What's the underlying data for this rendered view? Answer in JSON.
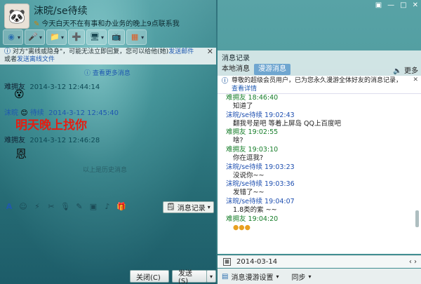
{
  "contact": {
    "name": "沫晥/se待续",
    "status": "今天白天不在有事和办业务的晚上9点联系我",
    "avatar_glyph": "🐼"
  },
  "toolbar": {
    "items": [
      {
        "name": "video-call-icon",
        "glyph": "◉"
      },
      {
        "name": "voice-call-icon",
        "glyph": "🎤"
      },
      {
        "name": "folder-icon",
        "glyph": "📁"
      },
      {
        "name": "add-contact-icon",
        "glyph": "➕"
      },
      {
        "name": "remote-icon",
        "glyph": "🖥"
      },
      {
        "name": "screen-share-icon",
        "glyph": "📺"
      },
      {
        "name": "apps-icon",
        "glyph": "▦"
      }
    ]
  },
  "notice": {
    "text": "对方\"离线或隐身\"，可能无法立即回复，您可以给他(她)",
    "link1": "发送邮件",
    "mid": "或者",
    "link2": "发送离线文件"
  },
  "conversation": {
    "more_messages": "查看更多消息",
    "messages": [
      {
        "who": "难拥友",
        "time": "2014-3-12 12:44:14"
      },
      {
        "who": "沫晥",
        "who_suffix": "待续",
        "time": "2014-3-12 12:45:40",
        "text": "明天晚上找你"
      },
      {
        "who": "难拥友",
        "time": "2014-3-12 12:46:28",
        "text": "恩"
      }
    ],
    "faint_text": "以上是历史消息"
  },
  "input_toolbar": {
    "icons": [
      "font-icon",
      "emoji-icon",
      "shake-icon",
      "screenshot-icon",
      "voice-icon",
      "pencil-icon",
      "image-icon",
      "music-icon",
      "gift-icon"
    ],
    "history_button": "消息记录"
  },
  "buttons": {
    "close": "关闭(C)",
    "send": "发送(S)",
    "dropdown": "▾"
  },
  "window_controls": [
    "▣",
    "—",
    "□",
    "✕"
  ],
  "history": {
    "title": "消息记录",
    "tab_local": "本地消息",
    "tab_roaming": "漫游消息",
    "more": "更多",
    "notice_text": "尊敬的超级会员用户，已为您永久漫游全体好友的消息记录，",
    "notice_link": "查看详情",
    "items": [
      {
        "who": "难拥友",
        "time": "18:46:40",
        "text": "知道了",
        "other": false
      },
      {
        "who": "沫晥/se待续",
        "time": "19:02:43",
        "text": "翻我号是吧  等着上屏岛  QQ上百度吧",
        "other": true
      },
      {
        "who": "难拥友",
        "time": "19:02:55",
        "text": "啥?",
        "other": false
      },
      {
        "who": "难拥友",
        "time": "19:03:10",
        "text": "你在逗我?",
        "other": false
      },
      {
        "who": "沫晥/se待续",
        "time": "19:03:23",
        "text": "没说你~~",
        "other": true
      },
      {
        "who": "沫晥/se待续",
        "time": "19:03:36",
        "text": "发错了~~",
        "other": true
      },
      {
        "who": "沫晥/se待续",
        "time": "19:04:07",
        "text": "1.8类的紫  ~~",
        "other": true
      },
      {
        "who": "难拥友",
        "time": "19:04:20",
        "text": "",
        "other": false
      }
    ],
    "date": "2014-03-14",
    "nav": "‹   ›",
    "footer_settings": "消息漫游设置",
    "footer_sync": "同步"
  }
}
